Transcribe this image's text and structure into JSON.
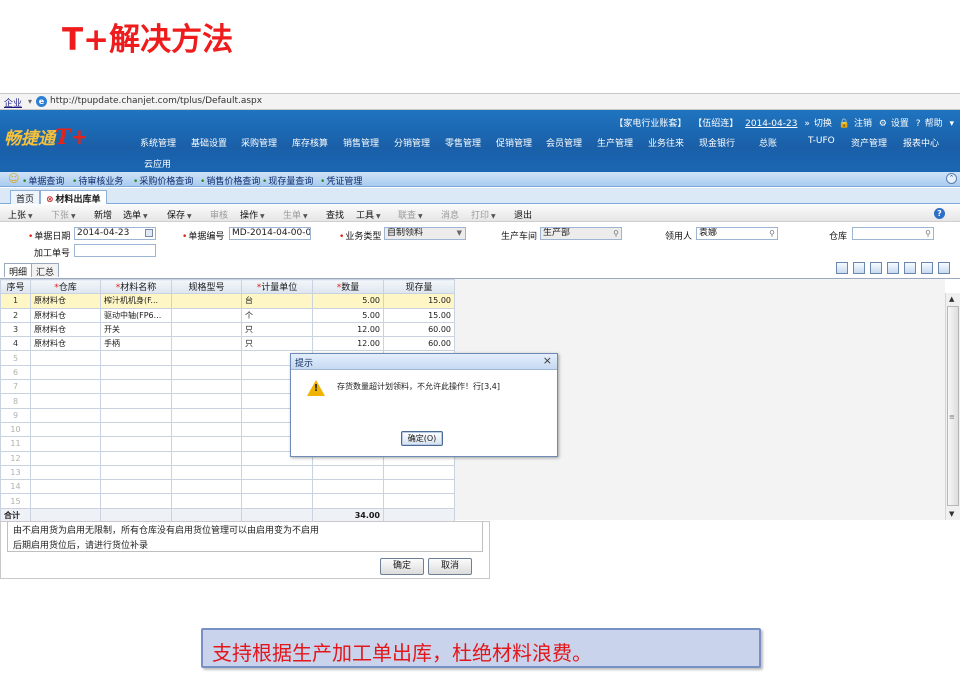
{
  "slide": {
    "title": "T+解决方法",
    "caption": "支持根据生产加工单出库，杜绝材料浪费。"
  },
  "browser": {
    "menu_label": "企业",
    "url": "http://tpupdate.chanjet.com/tplus/Default.aspx"
  },
  "app": {
    "logo_text": "畅捷通",
    "logo_mark": "T+",
    "account": "【家电行业账套】",
    "user": "【伍绍连】",
    "date": "2014-04-23",
    "switch_label": "切换",
    "logout_label": "注销",
    "settings_label": "设置",
    "help_label": "帮助",
    "nav": [
      "系统管理",
      "基础设置",
      "采购管理",
      "库存核算",
      "销售管理",
      "分销管理",
      "零售管理",
      "促销管理",
      "会员管理",
      "生产管理",
      "业务往来",
      "现金银行",
      "总账",
      "T-UFO",
      "资产管理",
      "报表中心"
    ],
    "cloud_app": "云应用",
    "quick": [
      "单据查询",
      "待审核业务",
      "采购价格查询",
      "销售价格查询",
      "现存量查询",
      "凭证管理"
    ],
    "tabs": [
      "首页",
      "材料出库单"
    ]
  },
  "toolbar": {
    "items": [
      {
        "label": "上张",
        "disabled": false,
        "dropdown": true
      },
      {
        "label": "下张",
        "disabled": true,
        "dropdown": true
      },
      {
        "label": "新增",
        "disabled": false,
        "dropdown": false
      },
      {
        "label": "选单",
        "disabled": false,
        "dropdown": true
      },
      {
        "label": "保存",
        "disabled": false,
        "dropdown": true
      },
      {
        "label": "审核",
        "disabled": true,
        "dropdown": false
      },
      {
        "label": "操作",
        "disabled": false,
        "dropdown": true
      },
      {
        "label": "生单",
        "disabled": true,
        "dropdown": true
      },
      {
        "label": "查找",
        "disabled": false,
        "dropdown": false
      },
      {
        "label": "工具",
        "disabled": false,
        "dropdown": true
      },
      {
        "label": "联查",
        "disabled": true,
        "dropdown": true
      },
      {
        "label": "消息",
        "disabled": true,
        "dropdown": false
      },
      {
        "label": "打印",
        "disabled": true,
        "dropdown": true
      },
      {
        "label": "退出",
        "disabled": false,
        "dropdown": false
      }
    ]
  },
  "form": {
    "date_label": "单据日期",
    "date_value": "2014-04-23",
    "doc_no_label": "单据编号",
    "doc_no_value": "MD-2014-04-00-000",
    "biz_type_label": "业务类型",
    "biz_type_value": "自制领料",
    "workshop_label": "生产车间",
    "workshop_value": "生产部",
    "picker_label": "领用人",
    "picker_value": "袁娜",
    "warehouse_label": "仓库",
    "warehouse_value": "",
    "process_no_label": "加工单号",
    "process_no_value": ""
  },
  "subtabs": [
    "明细",
    "汇总"
  ],
  "grid": {
    "headers": [
      "序号",
      "仓库",
      "材料名称",
      "规格型号",
      "计量单位",
      "数量",
      "现存量"
    ],
    "required": [
      false,
      true,
      true,
      false,
      true,
      true,
      false
    ],
    "rows": [
      [
        "1",
        "原材料仓",
        "榨汁机机身(F...",
        "",
        "台",
        "5.00",
        "15.00"
      ],
      [
        "2",
        "原材料仓",
        "驱动中轴(FP6...",
        "",
        "个",
        "5.00",
        "15.00"
      ],
      [
        "3",
        "原材料仓",
        "开关",
        "",
        "只",
        "12.00",
        "60.00"
      ],
      [
        "4",
        "原材料仓",
        "手柄",
        "",
        "只",
        "12.00",
        "60.00"
      ]
    ],
    "empty_rows": [
      "5",
      "6",
      "7",
      "8",
      "9",
      "10",
      "11",
      "12",
      "13",
      "14",
      "15"
    ],
    "total_label": "合计",
    "total_qty": "34.00"
  },
  "alert": {
    "title": "提示",
    "message": "存货数量超计划领料，不允许此操作！行[3,4]",
    "ok_label": "确定(O)"
  },
  "under_dialog": {
    "line1": "由不启用货为启用无限制，所有仓库没有启用货位管理可以由启用变为不启用",
    "line2": "后期启用货位后，请进行货位补录",
    "ok_label": "确定",
    "cancel_label": "取消"
  }
}
